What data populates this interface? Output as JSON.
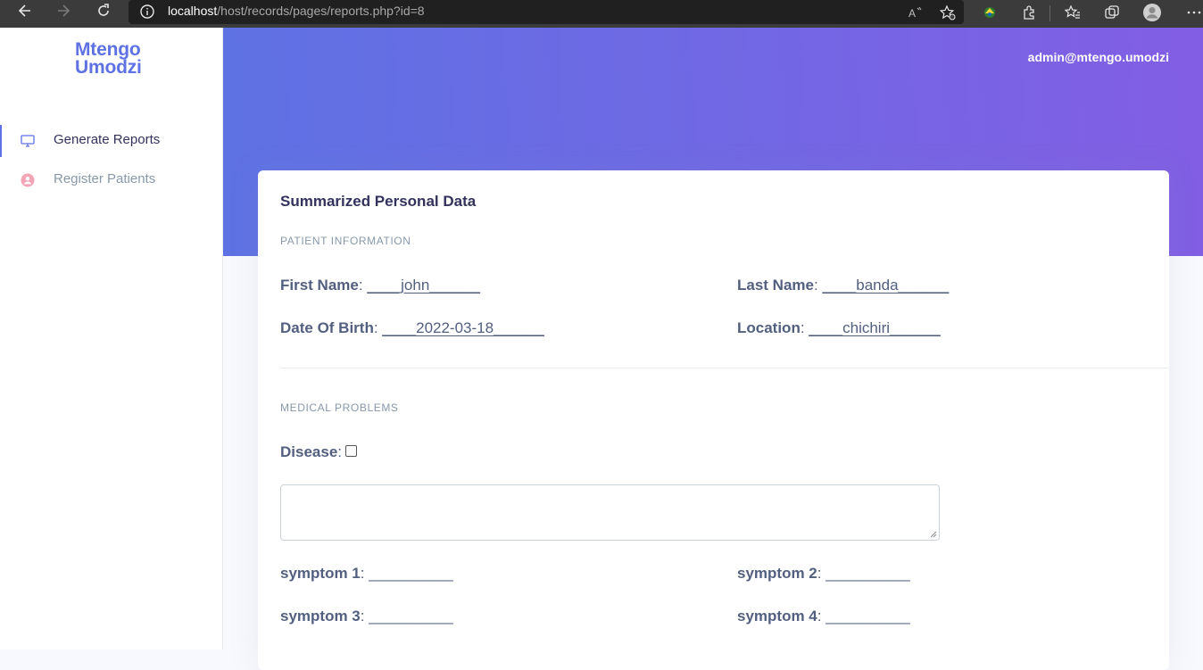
{
  "browser": {
    "url_host": "localhost",
    "url_path": "/host/records/pages/reports.php?id=8"
  },
  "sidebar": {
    "logo_line1": "Mtengo",
    "logo_line2": "Umodzi",
    "items": [
      {
        "label": "Generate Reports",
        "icon": "monitor-icon",
        "active": true
      },
      {
        "label": "Register Patients",
        "icon": "user-circle-icon",
        "active": false
      }
    ]
  },
  "header": {
    "user_email": "admin@mtengo.umodzi"
  },
  "card": {
    "title": "Summarized Personal Data",
    "patient_section": "PATIENT INFORMATION",
    "first_name_label": "First Name",
    "first_name_value": "____john______",
    "last_name_label": "Last Name",
    "last_name_value": "____banda______",
    "dob_label": "Date Of Birth",
    "dob_value": "____2022-03-18______",
    "location_label": "Location",
    "location_value": "____chichiri______",
    "medical_section": "MEDICAL PROBLEMS",
    "disease_label": "Disease",
    "symptom1_label": "symptom 1",
    "symptom1_value": "__________",
    "symptom2_label": "symptom 2",
    "symptom2_value": "__________",
    "symptom3_label": "symptom 3",
    "symptom3_value": "__________",
    "symptom4_label": "symptom 4",
    "symptom4_value": "__________"
  },
  "colors": {
    "accent": "#5e72e4",
    "gradient_end": "#825ee4",
    "heading_text": "#32325d",
    "muted_text": "#8898aa"
  }
}
